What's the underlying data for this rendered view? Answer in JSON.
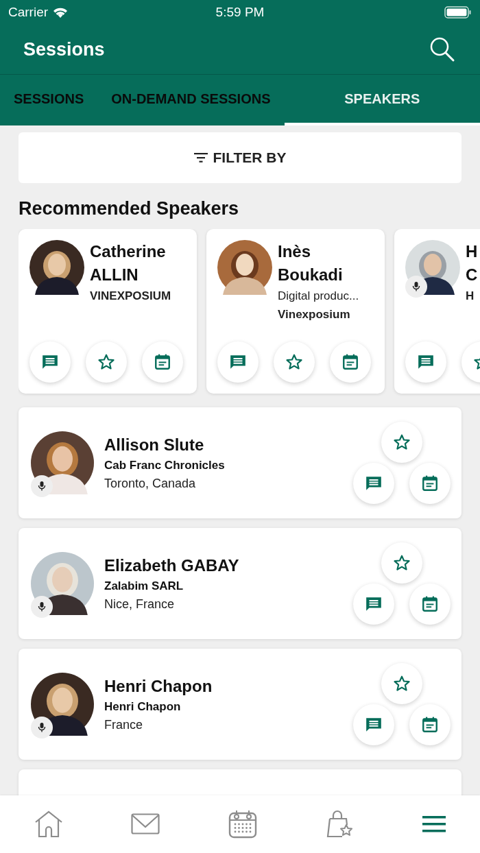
{
  "status_bar": {
    "carrier": "Carrier",
    "time": "5:59 PM"
  },
  "header": {
    "title": "Sessions"
  },
  "tabs": [
    {
      "label": "SESSIONS",
      "selected": false
    },
    {
      "label": "ON-DEMAND SESSIONS",
      "selected": false
    },
    {
      "label": "SPEAKERS",
      "selected": true
    }
  ],
  "filter": {
    "label": "FILTER BY"
  },
  "recommended": {
    "title": "Recommended Speakers",
    "cards": [
      {
        "first_name": "Catherine",
        "last_name": "ALLIN",
        "lines": [
          {
            "text": "VINEXPOSIUM",
            "bold": true
          }
        ],
        "speaker_badge": false
      },
      {
        "first_name": "Inès",
        "last_name": "Boukadi",
        "lines": [
          {
            "text": "Digital produc...",
            "bold": false
          },
          {
            "text": "Vinexposium",
            "bold": true
          }
        ],
        "speaker_badge": false
      },
      {
        "first_name": "H",
        "last_name": "C",
        "lines": [
          {
            "text": "H",
            "bold": true
          }
        ],
        "speaker_badge": true
      }
    ]
  },
  "speakers": [
    {
      "name": "Allison Slute",
      "company": "Cab Franc Chronicles",
      "location": "Toronto, Canada",
      "speaker_badge": true
    },
    {
      "name": "Elizabeth GABAY",
      "company": "Zalabim SARL",
      "location": "Nice, France",
      "speaker_badge": true
    },
    {
      "name": "Henri Chapon",
      "company": "Henri Chapon",
      "location": "France",
      "speaker_badge": true
    }
  ],
  "bottom_nav": [
    {
      "kind": "home",
      "selected": false
    },
    {
      "kind": "mail",
      "selected": false
    },
    {
      "kind": "calendar",
      "selected": false
    },
    {
      "kind": "bag",
      "selected": false
    },
    {
      "kind": "menu",
      "selected": true
    }
  ]
}
